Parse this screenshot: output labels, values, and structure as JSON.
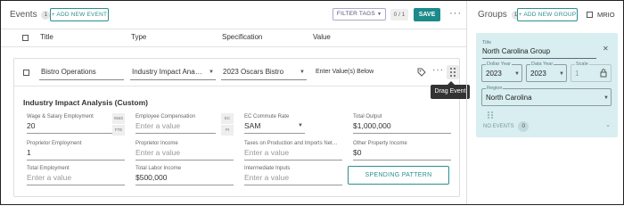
{
  "events": {
    "title": "Events",
    "count": "1",
    "add_button": "+ ADD NEW EVENT",
    "filter_tags": "FILTER TAGS",
    "selection_count": "0 / 1",
    "save_button": "SAVE",
    "more": "···"
  },
  "columns": [
    "Title",
    "Type",
    "Specification",
    "Value"
  ],
  "event_row": {
    "title": "Bistro Operations",
    "type": "Industry Impact Ana…",
    "specification": "2023 Oscars Bistro",
    "value": "Enter Value(s) Below",
    "drag_tooltip": "Drag Event"
  },
  "analysis": {
    "section_title": "Industry Impact Analysis (Custom)",
    "fields": [
      {
        "label": "Wage & Salary Employment",
        "value": "20",
        "placeholder": "",
        "tag_top": "W&S",
        "tag_bottom": "FTE"
      },
      {
        "label": "Employee Compensation",
        "value": "",
        "placeholder": "Enter a value",
        "tag_top": "EC",
        "tag_bottom": "PI"
      },
      {
        "label": "EC Commute Rate",
        "value": "SAM",
        "placeholder": ""
      },
      {
        "label": "Total Output",
        "value": "$1,000,000",
        "placeholder": ""
      },
      {
        "label": "Proprietor Employment",
        "value": "1",
        "placeholder": ""
      },
      {
        "label": "Proprietor Income",
        "value": "",
        "placeholder": "Enter a value"
      },
      {
        "label": "Taxes on Production and Imports Net…",
        "value": "",
        "placeholder": "Enter a value"
      },
      {
        "label": "Other Property Income",
        "value": "$0",
        "placeholder": ""
      },
      {
        "label": "Total Employment",
        "value": "",
        "placeholder": "Enter a value"
      },
      {
        "label": "Total Labor Income",
        "value": "$500,000",
        "placeholder": ""
      },
      {
        "label": "Intermediate Inputs",
        "value": "",
        "placeholder": "Enter a value"
      }
    ],
    "spending_button": "SPENDING PATTERN"
  },
  "groups": {
    "title": "Groups",
    "count": "1",
    "add_button": "+ ADD NEW GROUP",
    "mrio_label": "MRIO",
    "group_title_label": "Title",
    "group_title": "North Carolina Group",
    "dollar_year_label": "Dollar Year",
    "dollar_year": "2023",
    "data_year_label": "Data Year",
    "data_year": "2023",
    "scale_label": "Scale",
    "scale": "1",
    "region_label": "Region",
    "region": "North Carolina",
    "no_events": "NO EVENTS",
    "no_events_count": "0"
  },
  "colors": {
    "accent": "#1d8a8a",
    "group_panel": "#d8eef0"
  },
  "icons": [
    "tag-icon",
    "more-icon",
    "drag-handle-icon",
    "chevron-down-icon",
    "lock-icon",
    "close-icon"
  ]
}
